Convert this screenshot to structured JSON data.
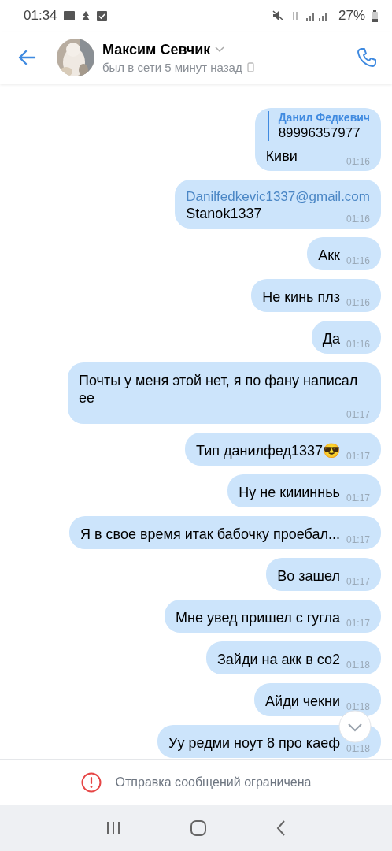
{
  "status_bar": {
    "time": "01:34",
    "battery": "27%"
  },
  "header": {
    "name": "Максим Севчик",
    "last_seen": "был в сети 5 минут назад"
  },
  "messages": [
    {
      "kind": "quote",
      "quote_author": "Данил Федкевич",
      "quote_text": "89996357977",
      "text": "Киви",
      "time": "01:16"
    },
    {
      "kind": "email",
      "link": "Danilfedkevic1337@gmail.com",
      "text": "Stanok1337",
      "time": "01:16"
    },
    {
      "kind": "text",
      "text": "Акк",
      "time": "01:16"
    },
    {
      "kind": "text",
      "text": "Не кинь плз",
      "time": "01:16"
    },
    {
      "kind": "text",
      "text": "Да",
      "time": "01:16"
    },
    {
      "kind": "text",
      "text": "Почты у меня этой нет, я по фану написал ее",
      "time": "01:17"
    },
    {
      "kind": "text",
      "text": "Тип данилфед1337😎",
      "time": "01:17"
    },
    {
      "kind": "text",
      "text": "Ну не кииинньь",
      "time": "01:17"
    },
    {
      "kind": "text",
      "text": "Я в свое время итак бабочку проебал...",
      "time": "01:17"
    },
    {
      "kind": "text",
      "text": "Во зашел",
      "time": "01:17"
    },
    {
      "kind": "text",
      "text": "Мне увед пришел с гугла",
      "time": "01:17"
    },
    {
      "kind": "text",
      "text": "Зайди на акк в со2",
      "time": "01:18"
    },
    {
      "kind": "text",
      "text": "Айди чекни",
      "time": "01:18"
    },
    {
      "kind": "text",
      "text": "Уу редми ноут 8 про каеф",
      "time": "01:18"
    }
  ],
  "notice": "Отправка сообщений ограничена"
}
